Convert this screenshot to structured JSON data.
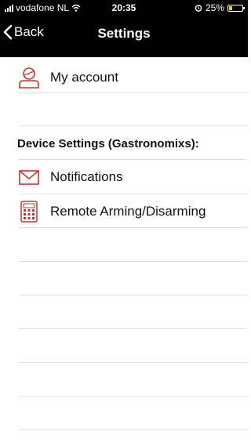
{
  "status": {
    "carrier": "vodafone NL",
    "time": "20:35",
    "battery_percent": "25%",
    "battery_level": 0.25,
    "battery_color": "#f5d000"
  },
  "nav": {
    "back_label": "Back",
    "title": "Settings"
  },
  "account": {
    "label": "My account",
    "icon": "user-icon"
  },
  "section": {
    "title": "Device Settings (Gastronomixs):"
  },
  "device_items": [
    {
      "label": "Notifications",
      "icon": "envelope-icon"
    },
    {
      "label": "Remote Arming/Disarming",
      "icon": "keypad-icon"
    }
  ],
  "accent_color": "#b63a2e"
}
